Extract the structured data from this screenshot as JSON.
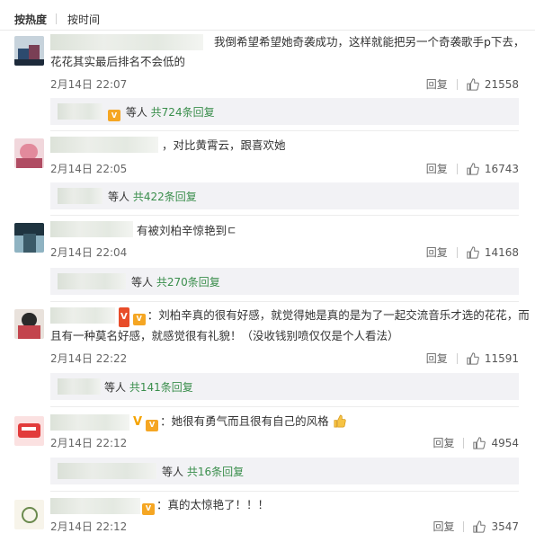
{
  "sort": {
    "hot_label": "按热度",
    "time_label": "按时间"
  },
  "comments": [
    {
      "text": "我倒希望希望她奇袭成功，这样就能把另一个奇袭歌手p下去，",
      "text_line2": "花花其实最后排名不会低的",
      "time": "2月14日 22:07",
      "reply_label": "回复",
      "like_count": "21558",
      "replies": {
        "suffix": "等人",
        "link": "共724条回复"
      }
    },
    {
      "text": "，对比黄霄云，跟喜欢她",
      "time": "2月14日 22:05",
      "reply_label": "回复",
      "like_count": "16743",
      "replies": {
        "suffix": "等人",
        "link": "共422条回复"
      }
    },
    {
      "text": "有被刘柏辛惊艳到ㄷ",
      "time": "2月14日 22:04",
      "reply_label": "回复",
      "like_count": "14168",
      "replies": {
        "suffix": "等人",
        "link": "共270条回复"
      }
    },
    {
      "text": "：刘柏辛真的很有好感，就觉得她是真的是为了一起交流音乐才选的花花，而",
      "text_line2": "且有一种莫名好感，就感觉很有礼貌！（没收钱别喷仅仅是个人看法）",
      "time": "2月14日 22:22",
      "reply_label": "回复",
      "like_count": "11591",
      "replies": {
        "suffix": "等人",
        "link": "共141条回复"
      }
    },
    {
      "text": "：她很有勇气而且很有自己的风格",
      "time": "2月14日 22:12",
      "reply_label": "回复",
      "like_count": "4954",
      "replies": {
        "suffix": "等人",
        "link": "共16条回复"
      }
    },
    {
      "text": "：真的太惊艳了！！！",
      "time": "2月14日 22:12",
      "reply_label": "回复",
      "like_count": "3547"
    }
  ],
  "badges": {
    "vip_text": "V",
    "v_verified": "V"
  },
  "colors": {
    "link_green": "#3a8e4c",
    "reply_bg": "#f2f2f5",
    "vip_orange": "#f5a623"
  },
  "icons": {
    "like": "thumbs-up-icon",
    "emoji": "thumbs-up-emoji"
  }
}
